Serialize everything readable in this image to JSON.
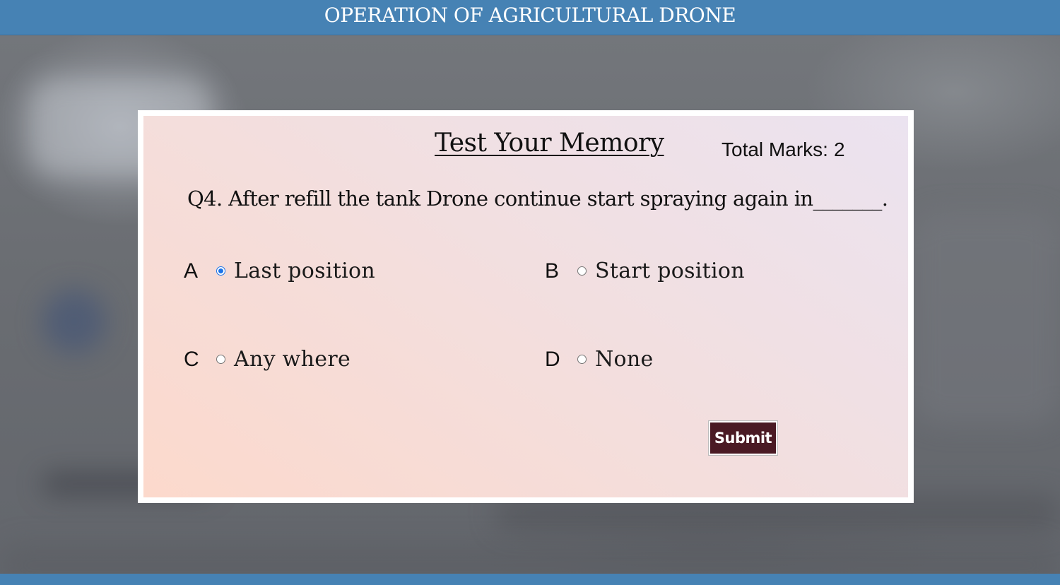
{
  "header": {
    "title": "OPERATION OF AGRICULTURAL DRONE"
  },
  "quiz": {
    "title": "Test Your Memory",
    "total_marks_label": "Total Marks:",
    "total_marks_value": "2",
    "question": "Q4. After refill the tank Drone continue start spraying again in_______.",
    "options": [
      {
        "letter": "A",
        "text": "Last position",
        "selected": true
      },
      {
        "letter": "B",
        "text": "Start position",
        "selected": false
      },
      {
        "letter": "C",
        "text": "Any where",
        "selected": false
      },
      {
        "letter": "D",
        "text": "None",
        "selected": false
      }
    ],
    "submit_label": "Submit"
  },
  "colors": {
    "header_bar": "#4682b4",
    "submit_button": "#4a1a24",
    "radio_selected": "#1a73e8"
  }
}
